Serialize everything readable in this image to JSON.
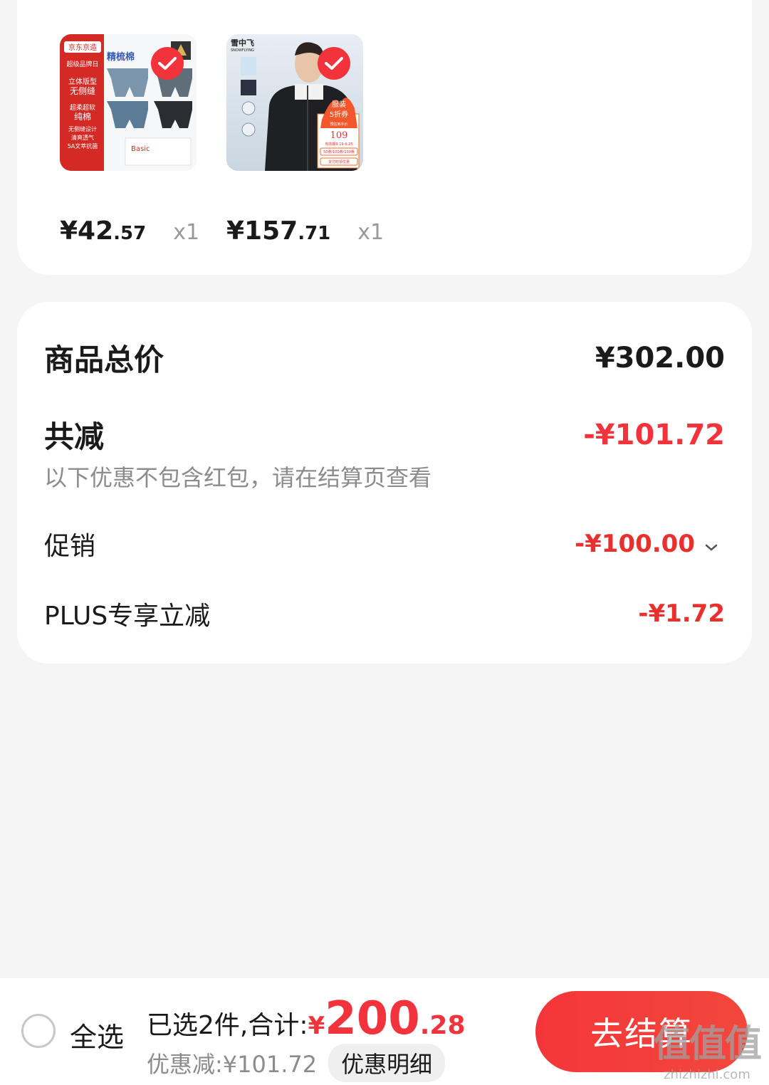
{
  "products": [
    {
      "image_text": {
        "brand": "京东京造",
        "tag": "超级品牌日",
        "title": "精梳棉",
        "line1": "立体版型",
        "line2": "无侧缝",
        "line3": "超柔超软",
        "line4": "纯棉",
        "line5": "无侧缝设计",
        "line6": "清爽透气",
        "line7": "5A文萃抗菌",
        "box": "Basic"
      },
      "price_int": "¥42",
      "price_dec": ".57",
      "qty": "x1"
    },
    {
      "image_text": {
        "brand": "雪中飞",
        "brand_en": "SNOWFLYING",
        "badge1": "服装",
        "badge2": "5折券",
        "badge_small": "预估到手价",
        "badge_price": "109",
        "badge_dates": "有效期9.19-9.25",
        "coupon1": "50券/100券/100券",
        "coupon2": "支付时领优惠"
      },
      "price_int": "¥157",
      "price_dec": ".71",
      "qty": "x1"
    }
  ],
  "summary": {
    "total_label": "商品总价",
    "total_value": "¥302.00",
    "reduce_label": "共减",
    "reduce_value": "-¥101.72",
    "note": "以下优惠不包含红包，请在结算页查看",
    "promo_label": "促销",
    "promo_value": "-¥100.00",
    "plus_label": "PLUS专享立减",
    "plus_value": "-¥1.72"
  },
  "bottom": {
    "select_all": "全选",
    "selected_label": "已选2件,合计:",
    "total_yen": "¥",
    "total_int": "200",
    "total_dec": ".28",
    "discount": "优惠减:¥101.72",
    "detail_button": "优惠明细",
    "checkout": "去结算"
  },
  "watermark": {
    "big": "值值值",
    "small": "zhizhizhi.com"
  },
  "colors": {
    "accent": "#f2333b",
    "background": "#f5f5f5",
    "card": "#ffffff",
    "muted": "#8c8c8c"
  }
}
